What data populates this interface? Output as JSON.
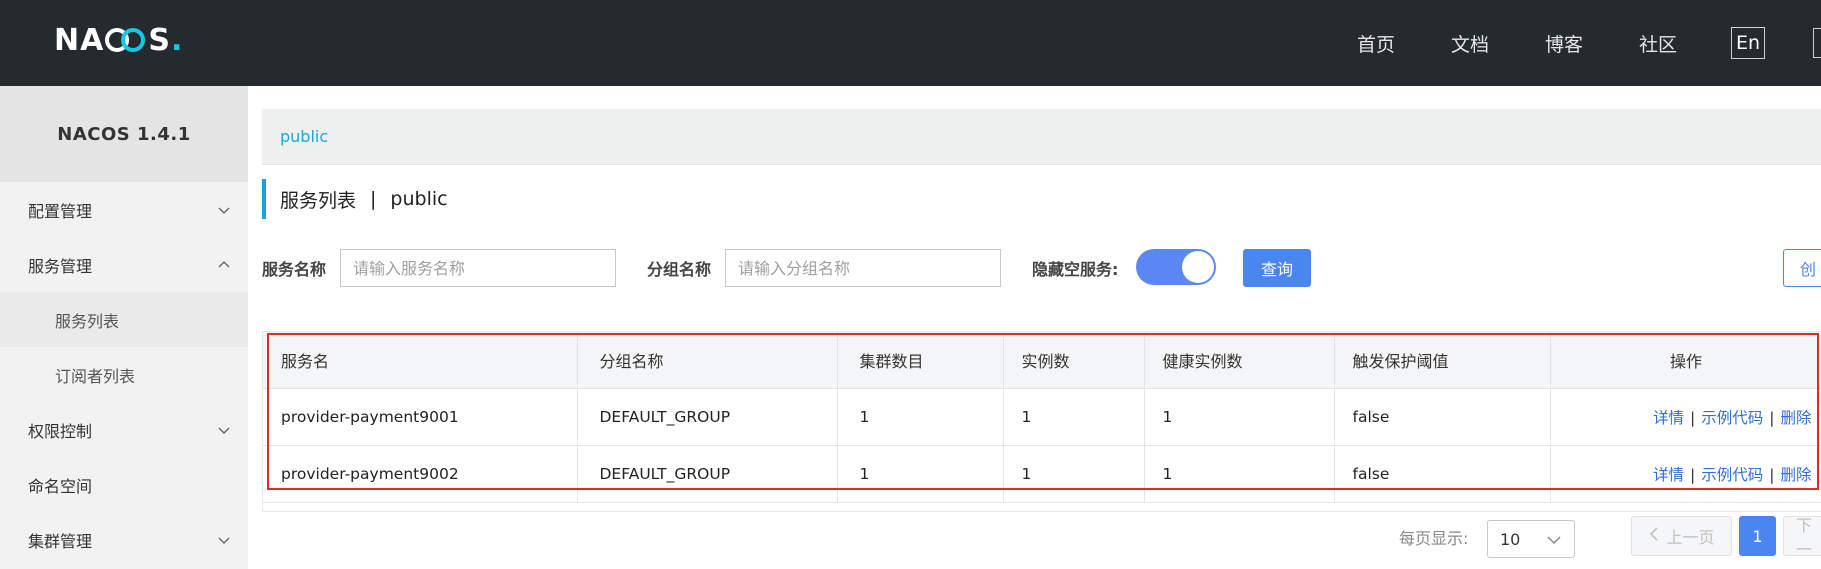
{
  "header": {
    "logo_text_left": "NA",
    "logo_text_right": "S",
    "logo_dot": ".",
    "nav": [
      "首页",
      "文档",
      "博客",
      "社区"
    ],
    "lang": "En"
  },
  "sidebar": {
    "version": "NACOS 1.4.1",
    "items": [
      {
        "label": "配置管理",
        "expanded": false
      },
      {
        "label": "服务管理",
        "expanded": true
      },
      {
        "label": "服务列表",
        "sub": true,
        "active": true
      },
      {
        "label": "订阅者列表",
        "sub": true
      },
      {
        "label": "权限控制",
        "expanded": false
      },
      {
        "label": "命名空间"
      },
      {
        "label": "集群管理",
        "expanded": false
      }
    ]
  },
  "namespace": {
    "current": "public"
  },
  "page": {
    "title": "服务列表",
    "separator": "|",
    "namespace": "public"
  },
  "filters": {
    "service_label": "服务名称",
    "service_placeholder": "请输入服务名称",
    "group_label": "分组名称",
    "group_placeholder": "请输入分组名称",
    "hide_empty_label": "隐藏空服务:",
    "hide_empty_on": true,
    "query_button": "查询",
    "create_button_partial": "创"
  },
  "table": {
    "columns": [
      "服务名",
      "分组名称",
      "集群数目",
      "实例数",
      "健康实例数",
      "触发保护阈值",
      "操作"
    ],
    "rows": [
      {
        "name": "provider-payment9001",
        "group": "DEFAULT_GROUP",
        "clusters": "1",
        "instances": "1",
        "healthy": "1",
        "threshold": "false"
      },
      {
        "name": "provider-payment9002",
        "group": "DEFAULT_GROUP",
        "clusters": "1",
        "instances": "1",
        "healthy": "1",
        "threshold": "false"
      }
    ],
    "ops": {
      "detail": "详情",
      "sample": "示例代码",
      "delete": "删除",
      "sep": "|"
    }
  },
  "pager": {
    "per_page_label": "每页显示:",
    "per_page_value": "10",
    "prev": "上一页",
    "current_page": "1",
    "next_partial": "下一"
  },
  "colors": {
    "header_bg": "#252a2f",
    "accent": "#4a86f0",
    "logo_accent": "#14c9e6",
    "highlight_box": "#e02b2b"
  }
}
